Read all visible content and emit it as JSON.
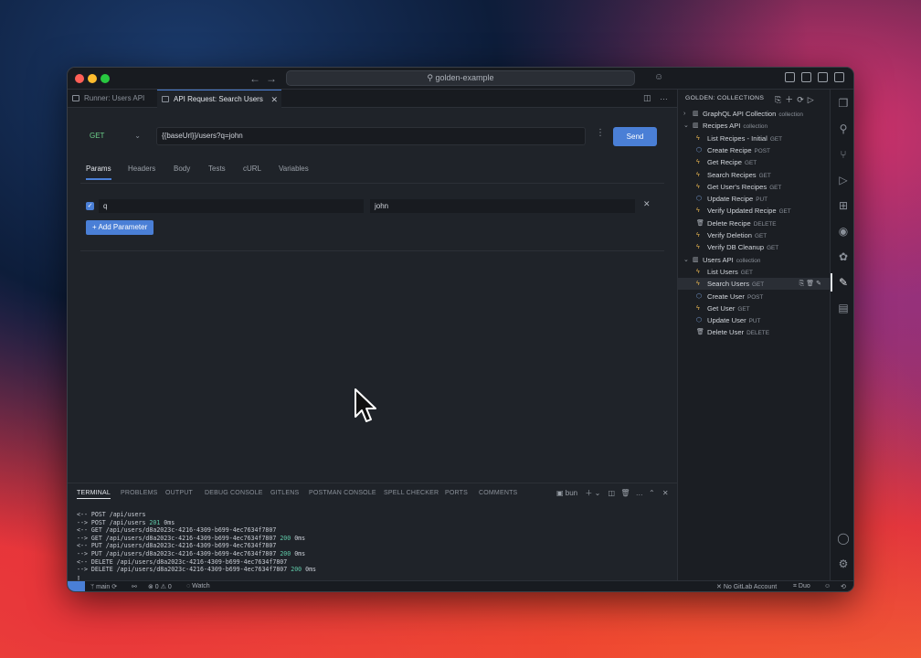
{
  "window": {
    "search_title": "golden-example"
  },
  "tabs": [
    {
      "label": "Runner: Users API"
    },
    {
      "label": "API Request: Search Users",
      "close": "✕"
    }
  ],
  "request": {
    "method": "GET",
    "url": "{{baseUrl}}/users?q=john",
    "send_label": "Send",
    "subtabs": [
      "Params",
      "Headers",
      "Body",
      "Tests",
      "cURL",
      "Variables"
    ],
    "params": [
      {
        "key": "q",
        "value": "john",
        "enabled": true
      }
    ],
    "add_param_label": "+ Add Parameter"
  },
  "terminal": {
    "tabs": [
      "TERMINAL",
      "PROBLEMS",
      "OUTPUT",
      "DEBUG CONSOLE",
      "GITLENS",
      "POSTMAN CONSOLE",
      "SPELL CHECKER",
      "PORTS",
      "COMMENTS"
    ],
    "shell": "bun",
    "lines": [
      {
        "text": "<-- POST /api/users",
        "status": "",
        "time": ""
      },
      {
        "text": "--> POST /api/users ",
        "status": "201",
        "time": " 0ms"
      },
      {
        "text": "<-- GET /api/users/d8a2023c-4216-4309-b699-4ec7634f7807",
        "status": "",
        "time": ""
      },
      {
        "text": "--> GET /api/users/d8a2023c-4216-4309-b699-4ec7634f7807 ",
        "status": "200",
        "time": " 0ms"
      },
      {
        "text": "<-- PUT /api/users/d8a2023c-4216-4309-b699-4ec7634f7807",
        "status": "",
        "time": ""
      },
      {
        "text": "--> PUT /api/users/d8a2023c-4216-4309-b699-4ec7634f7807 ",
        "status": "200",
        "time": " 0ms"
      },
      {
        "text": "<-- DELETE /api/users/d8a2023c-4216-4309-b699-4ec7634f7807",
        "status": "",
        "time": ""
      },
      {
        "text": "--> DELETE /api/users/d8a2023c-4216-4309-b699-4ec7634f7807 ",
        "status": "200",
        "time": " 0ms"
      },
      {
        "text": "▯",
        "status": "",
        "time": ""
      }
    ]
  },
  "statusbar": {
    "branch": "main",
    "problems": "⊗ 0 ⚠ 0",
    "watch": "Watch",
    "gitlab": "No GitLab Account",
    "duo": "Duo"
  },
  "sidebar": {
    "header": "GOLDEN: COLLECTIONS",
    "tree": [
      {
        "level": 0,
        "type": "collection",
        "label": "GraphQL API Collection",
        "meta": "collection",
        "expanded": false
      },
      {
        "level": 0,
        "type": "collection",
        "label": "Recipes API",
        "meta": "collection",
        "expanded": true
      },
      {
        "level": 1,
        "type": "bolt",
        "label": "List Recipes - Initial",
        "meta": "GET"
      },
      {
        "level": 1,
        "type": "cube",
        "label": "Create Recipe",
        "meta": "POST"
      },
      {
        "level": 1,
        "type": "bolt",
        "label": "Get Recipe",
        "meta": "GET"
      },
      {
        "level": 1,
        "type": "bolt",
        "label": "Search Recipes",
        "meta": "GET"
      },
      {
        "level": 1,
        "type": "bolt",
        "label": "Get User's Recipes",
        "meta": "GET"
      },
      {
        "level": 1,
        "type": "cube",
        "label": "Update Recipe",
        "meta": "PUT"
      },
      {
        "level": 1,
        "type": "bolt",
        "label": "Verify Updated Recipe",
        "meta": "GET"
      },
      {
        "level": 1,
        "type": "trash",
        "label": "Delete Recipe",
        "meta": "DELETE"
      },
      {
        "level": 1,
        "type": "bolt",
        "label": "Verify Deletion",
        "meta": "GET"
      },
      {
        "level": 1,
        "type": "bolt",
        "label": "Verify DB Cleanup",
        "meta": "GET"
      },
      {
        "level": 0,
        "type": "collection",
        "label": "Users API",
        "meta": "collection",
        "expanded": true
      },
      {
        "level": 1,
        "type": "bolt",
        "label": "List Users",
        "meta": "GET"
      },
      {
        "level": 1,
        "type": "bolt",
        "label": "Search Users",
        "meta": "GET",
        "selected": true
      },
      {
        "level": 1,
        "type": "cube",
        "label": "Create User",
        "meta": "POST"
      },
      {
        "level": 1,
        "type": "bolt",
        "label": "Get User",
        "meta": "GET"
      },
      {
        "level": 1,
        "type": "cube",
        "label": "Update User",
        "meta": "PUT"
      },
      {
        "level": 1,
        "type": "trash",
        "label": "Delete User",
        "meta": "DELETE"
      }
    ]
  },
  "colors": {
    "accent": "#4a7fd6",
    "method_get": "#6ccf8a",
    "status_ok": "#5fc9a8",
    "bolt": "#e6b450"
  }
}
